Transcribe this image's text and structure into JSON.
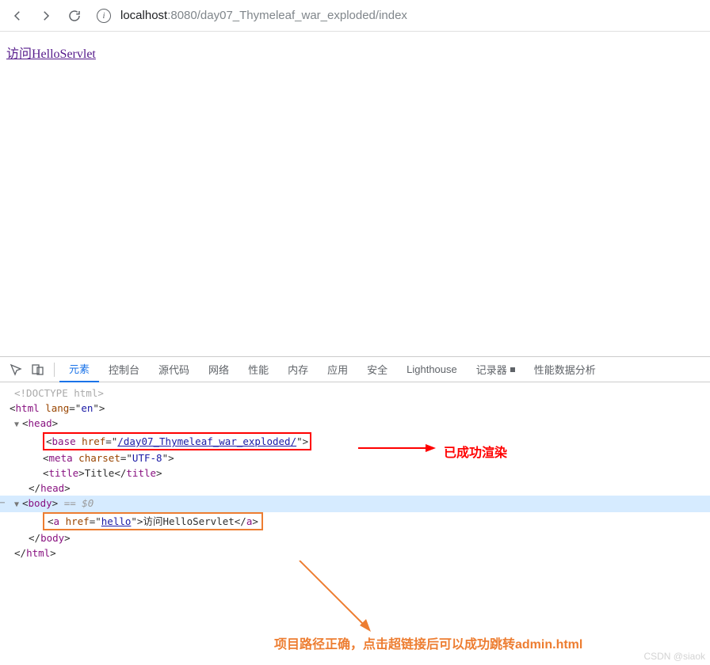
{
  "url": {
    "host": "localhost",
    "port": ":8080",
    "path": "/day07_Thymeleaf_war_exploded/index"
  },
  "page": {
    "link_text": "访问HelloServlet"
  },
  "devtools_tabs": {
    "elements": "元素",
    "console": "控制台",
    "sources": "源代码",
    "network": "网络",
    "performance": "性能",
    "memory": "内存",
    "application": "应用",
    "security": "安全",
    "lighthouse": "Lighthouse",
    "recorder": "记录器",
    "perfdata": "性能数据分析"
  },
  "html_source": {
    "doctype": "<!DOCTYPE html>",
    "html_open": "html",
    "html_lang_attr": "lang",
    "html_lang_val": "en",
    "head": "head",
    "base_tag": "base",
    "base_href_attr": "href",
    "base_href_val": "/day07_Thymeleaf_war_exploded/",
    "meta_tag": "meta",
    "meta_charset_attr": "charset",
    "meta_charset_val": "UTF-8",
    "title_tag": "title",
    "title_text": "Title",
    "body": "body",
    "body_eq": " == $0",
    "a_tag": "a",
    "a_href_attr": "href",
    "a_href_val": "hello",
    "a_text": "访问HelloServlet"
  },
  "annotation": {
    "red_text": "已成功渲染",
    "orange_text": "项目路径正确，点击超链接后可以成功跳转admin.html"
  },
  "watermark": "CSDN @siaok"
}
